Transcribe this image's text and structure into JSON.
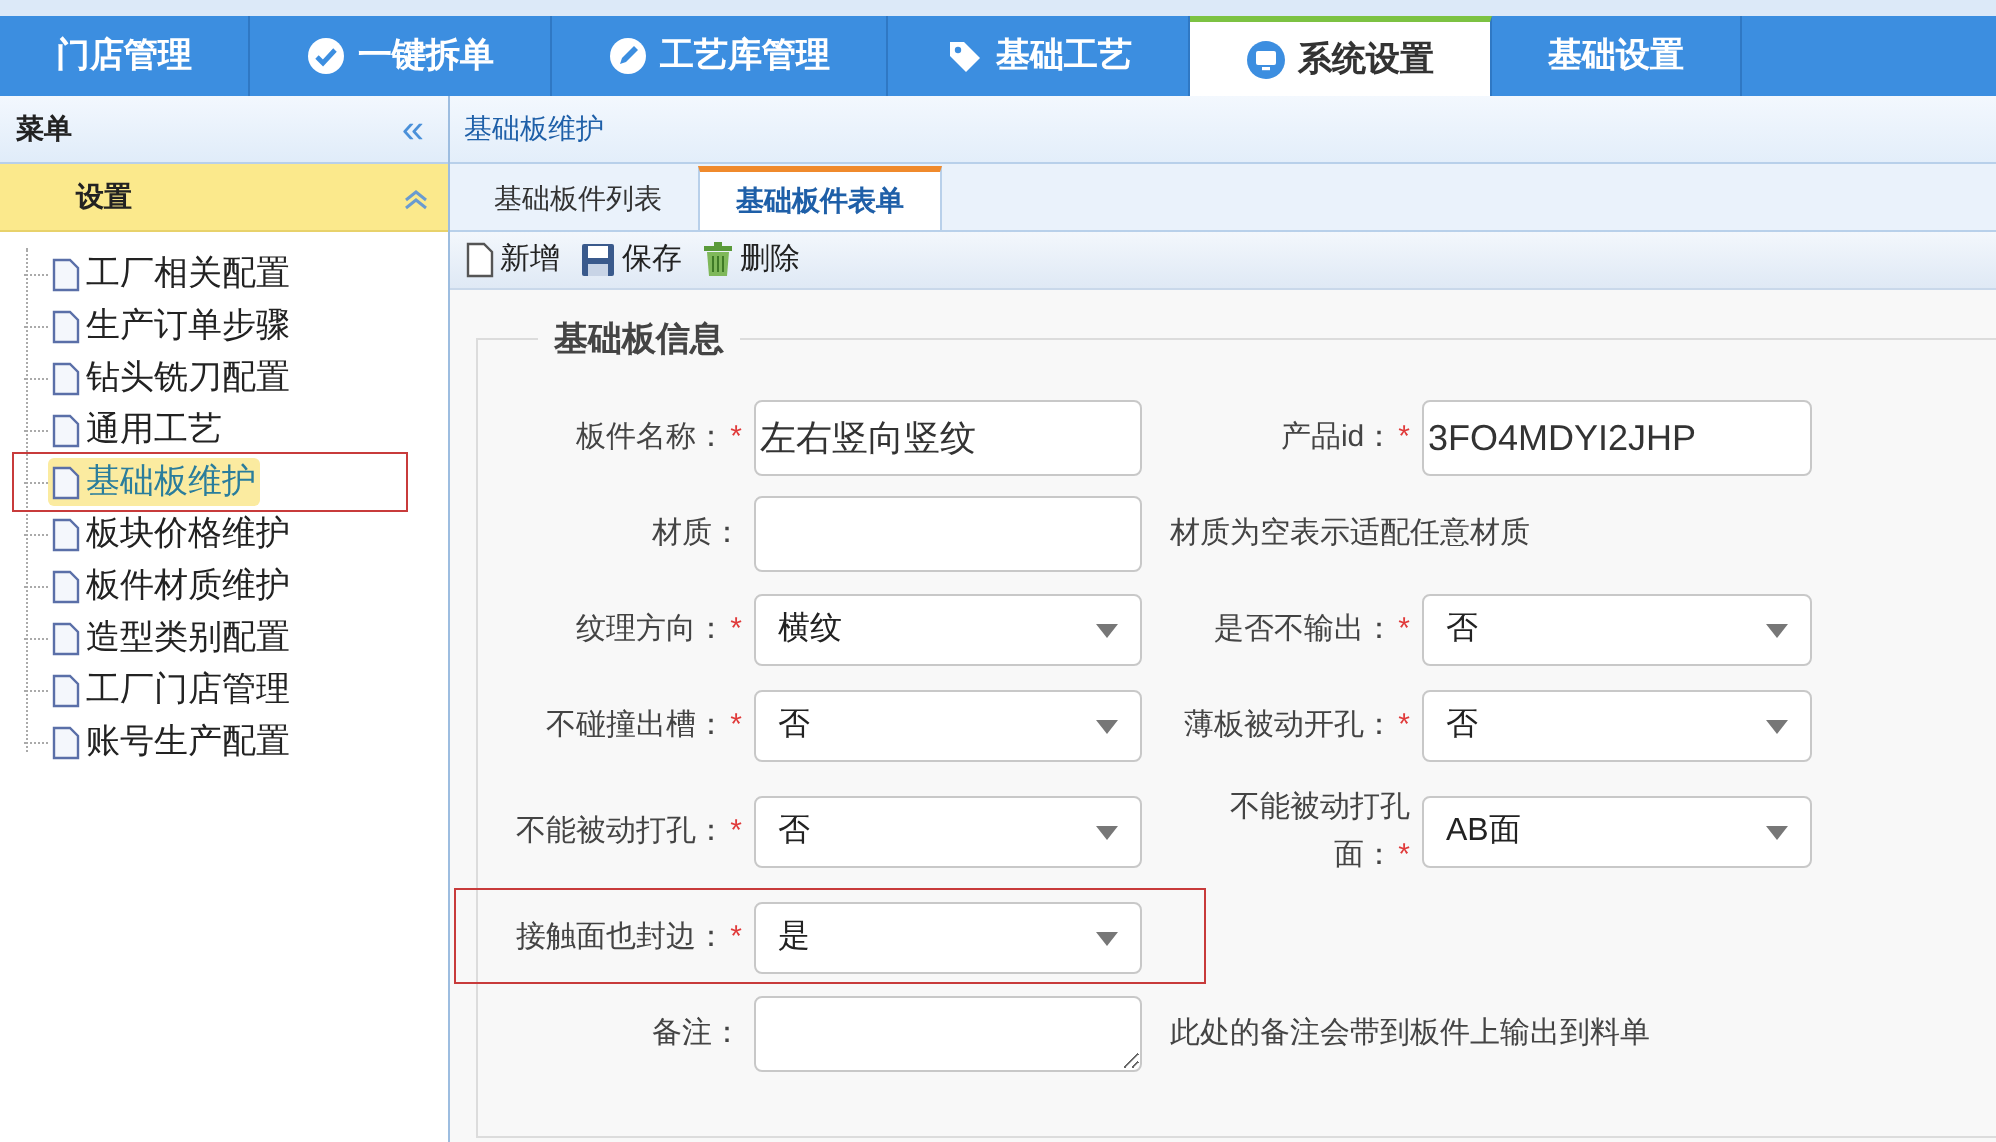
{
  "nav_tabs": [
    {
      "label": "门店管理",
      "selected": false
    },
    {
      "label": "一键拆单",
      "selected": false
    },
    {
      "label": "工艺库管理",
      "selected": false
    },
    {
      "label": "基础工艺",
      "selected": false
    },
    {
      "label": "系统设置",
      "selected": true
    },
    {
      "label": "基础设置",
      "selected": false
    }
  ],
  "sidebar": {
    "title": "菜单",
    "collapse_icon": "«",
    "group": {
      "label": "设置",
      "expanded": true
    },
    "items": [
      {
        "label": "工厂相关配置",
        "selected": false,
        "annotated": false
      },
      {
        "label": "生产订单步骤",
        "selected": false,
        "annotated": false
      },
      {
        "label": "钻头铣刀配置",
        "selected": false,
        "annotated": false
      },
      {
        "label": "通用工艺",
        "selected": false,
        "annotated": false
      },
      {
        "label": "基础板维护",
        "selected": true,
        "annotated": true
      },
      {
        "label": "板块价格维护",
        "selected": false,
        "annotated": false
      },
      {
        "label": "板件材质维护",
        "selected": false,
        "annotated": false
      },
      {
        "label": "造型类别配置",
        "selected": false,
        "annotated": false
      },
      {
        "label": "工厂门店管理",
        "selected": false,
        "annotated": false
      },
      {
        "label": "账号生产配置",
        "selected": false,
        "annotated": false
      }
    ]
  },
  "breadcrumb": "基础板维护",
  "tabs": [
    {
      "label": "基础板件列表",
      "selected": false
    },
    {
      "label": "基础板件表单",
      "selected": true
    }
  ],
  "toolbar": [
    {
      "label": "新增"
    },
    {
      "label": "保存"
    },
    {
      "label": "删除"
    }
  ],
  "form": {
    "legend": "基础板信息",
    "rows": [
      {
        "fields": [
          {
            "kind": "text",
            "label": "板件名称：",
            "required_mark": "*",
            "value": "左右竖向竖纹"
          },
          {
            "kind": "text",
            "label": "产品id：",
            "required_mark": "*",
            "value": "3FO4MDYI2JHP"
          }
        ]
      },
      {
        "fields": [
          {
            "kind": "text",
            "label": "材质："
          },
          {
            "kind": "note",
            "text": "材质为空表示适配任意材质"
          }
        ]
      },
      {
        "fields": [
          {
            "kind": "select",
            "label": "纹理方向：",
            "required_mark": "*",
            "value": "横纹"
          },
          {
            "kind": "select",
            "label": "是否不输出：",
            "required_mark": "*",
            "value": "否"
          }
        ]
      },
      {
        "fields": [
          {
            "kind": "select",
            "label": "不碰撞出槽：",
            "required_mark": "*",
            "value": "否"
          },
          {
            "kind": "select",
            "label": "薄板被动开孔：",
            "required_mark": "*",
            "value": "否"
          }
        ]
      },
      {
        "fields": [
          {
            "kind": "select",
            "label": "不能被动打孔：",
            "required_mark": "*",
            "value": "否"
          },
          {
            "kind": "select",
            "label": "不能被动打孔面：",
            "required_mark": "*",
            "value": "AB面"
          }
        ]
      },
      {
        "annotated": true,
        "fields": [
          {
            "kind": "select",
            "label": "接触面也封边：",
            "required_mark": "*",
            "value": "是"
          }
        ]
      },
      {
        "fields": [
          {
            "kind": "textarea",
            "label": "备注："
          },
          {
            "kind": "note",
            "text": "此处的备注会带到板件上输出到料单"
          }
        ]
      }
    ]
  }
}
